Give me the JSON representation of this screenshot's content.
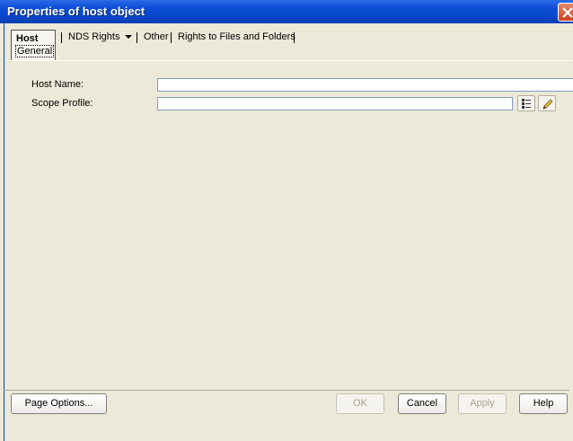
{
  "window": {
    "title": "Properties of host object"
  },
  "tabs": {
    "host": {
      "label": "Host",
      "sub_label": "General"
    },
    "nds_rights": {
      "label": "NDS Rights"
    },
    "other": {
      "label": "Other"
    },
    "rights_files": {
      "label": "Rights to Files and Folders"
    }
  },
  "form": {
    "host_name": {
      "label": "Host Name:",
      "value": ""
    },
    "scope_profile": {
      "label": "Scope Profile:",
      "value": ""
    }
  },
  "buttons": {
    "page_options": "Page Options...",
    "ok": "OK",
    "cancel": "Cancel",
    "apply": "Apply",
    "help": "Help"
  },
  "icons": {
    "close": "close-icon",
    "browse": "browse-list-icon",
    "edit": "pencil-icon"
  }
}
